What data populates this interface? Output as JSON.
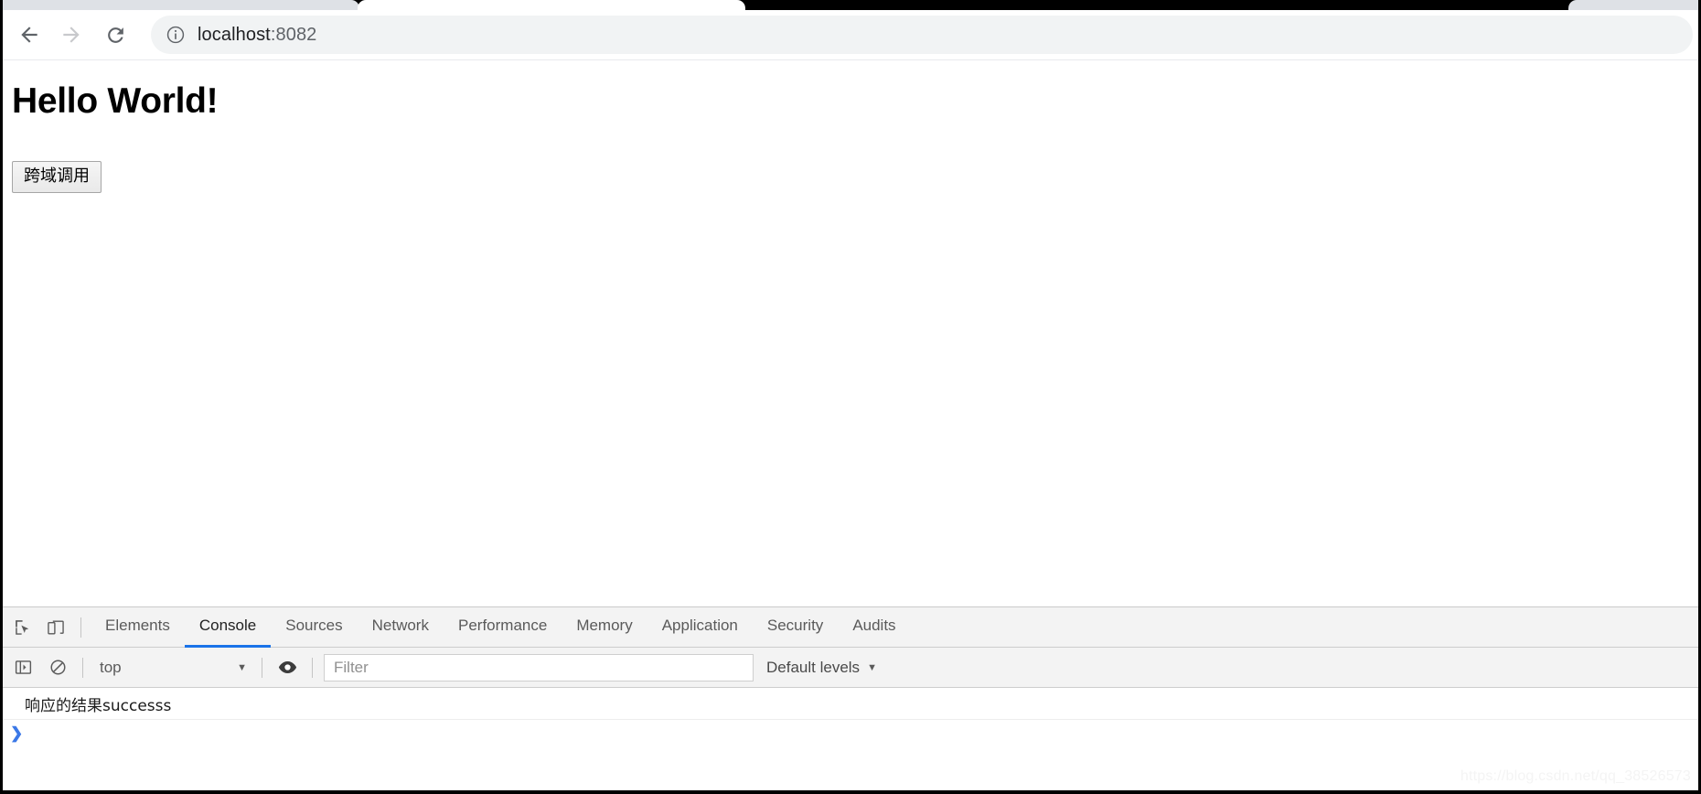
{
  "browser": {
    "nav": {
      "back_label": "Back",
      "forward_label": "Forward",
      "reload_label": "Reload"
    },
    "omnibox": {
      "site_info_label": "View site information",
      "url_host": "localhost",
      "url_rest": ":8082",
      "full_url": "localhost:8082"
    },
    "tabs": {
      "active_tab_title": ""
    }
  },
  "page": {
    "heading": "Hello World!",
    "button_label": "跨域调用"
  },
  "devtools": {
    "tabs": [
      {
        "label": "Elements",
        "active": false
      },
      {
        "label": "Console",
        "active": true
      },
      {
        "label": "Sources",
        "active": false
      },
      {
        "label": "Network",
        "active": false
      },
      {
        "label": "Performance",
        "active": false
      },
      {
        "label": "Memory",
        "active": false
      },
      {
        "label": "Application",
        "active": false
      },
      {
        "label": "Security",
        "active": false
      },
      {
        "label": "Audits",
        "active": false
      }
    ],
    "inspect_label": "Inspect element",
    "device_toolbar_label": "Toggle device toolbar",
    "console": {
      "sidebar_toggle_label": "Show console sidebar",
      "clear_label": "Clear console",
      "context": "top",
      "eye_label": "Create live expression",
      "filter_placeholder": "Filter",
      "filter_value": "",
      "log_levels": "Default levels",
      "caret": "▼",
      "messages": [
        {
          "text": "响应的结果successs"
        }
      ],
      "prompt_arrow": "❯"
    }
  },
  "watermark": "https://blog.csdn.net/qq_38526573"
}
